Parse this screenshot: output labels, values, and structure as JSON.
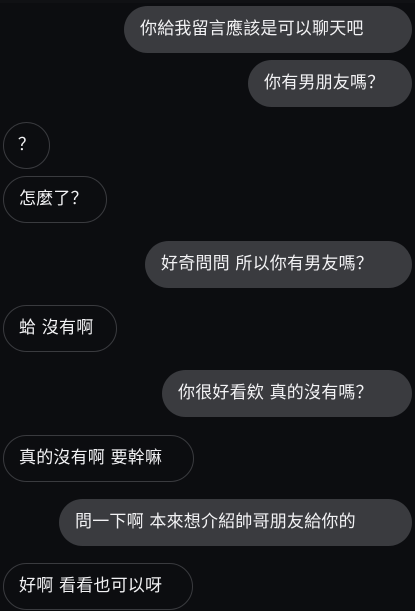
{
  "conversation": {
    "messages": [
      {
        "direction": "sent",
        "text": "你給我留言應該是可以聊天吧"
      },
      {
        "direction": "sent",
        "text": "你有男朋友嗎？"
      },
      {
        "direction": "received",
        "text": "？"
      },
      {
        "direction": "received",
        "text": "怎麼了？"
      },
      {
        "direction": "sent",
        "text": "好奇問問 所以你有男友嗎？"
      },
      {
        "direction": "received",
        "text": "蛤 沒有啊"
      },
      {
        "direction": "sent",
        "text": "你很好看欸 真的沒有嗎？"
      },
      {
        "direction": "received",
        "text": "真的沒有啊 要幹嘛"
      },
      {
        "direction": "sent",
        "text": "問一下啊 本來想介紹帥哥朋友給你的"
      },
      {
        "direction": "received",
        "text": "好啊 看看也可以呀"
      }
    ]
  },
  "colors": {
    "background": "#0c0d10",
    "sent_bubble": "#3a3b3f",
    "received_border": "#3a3b3f",
    "text": "#f2f2f4"
  }
}
